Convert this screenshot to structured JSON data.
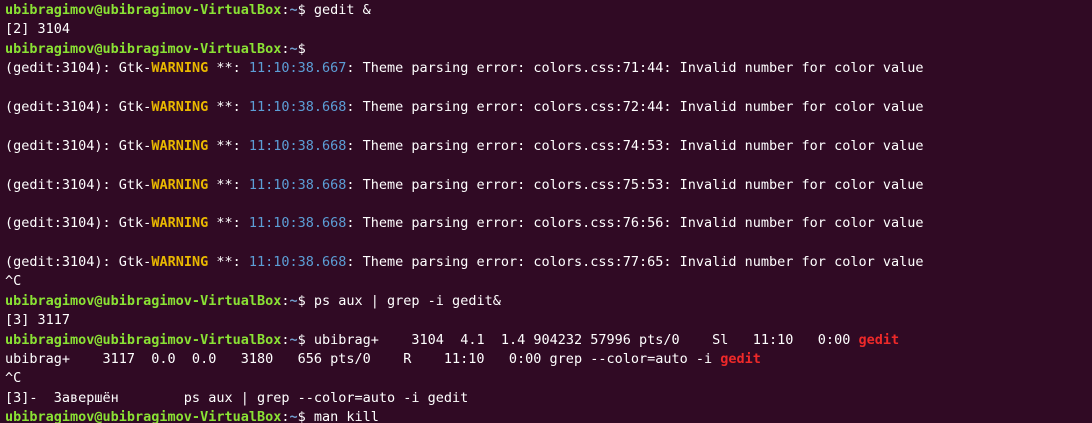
{
  "terminal": {
    "prompt": {
      "user_host": "ubibragimov@ubibragimov-VirtualBox",
      "colon": ":",
      "path": "~",
      "symbol": "$ "
    },
    "lines": [
      {
        "kind": "prompt",
        "cmd": "gedit &"
      },
      {
        "kind": "text",
        "text": "[2] 3104"
      },
      {
        "kind": "prompt",
        "cmd": ""
      },
      {
        "kind": "warning",
        "prefix": "(gedit:3104): Gtk-",
        "level": "WARNING",
        "mid": " **: ",
        "time": "11:10:38.667",
        "message": ": Theme parsing error: colors.css:71:44: Invalid number for color value"
      },
      {
        "kind": "blank"
      },
      {
        "kind": "warning",
        "prefix": "(gedit:3104): Gtk-",
        "level": "WARNING",
        "mid": " **: ",
        "time": "11:10:38.668",
        "message": ": Theme parsing error: colors.css:72:44: Invalid number for color value"
      },
      {
        "kind": "blank"
      },
      {
        "kind": "warning",
        "prefix": "(gedit:3104): Gtk-",
        "level": "WARNING",
        "mid": " **: ",
        "time": "11:10:38.668",
        "message": ": Theme parsing error: colors.css:74:53: Invalid number for color value"
      },
      {
        "kind": "blank"
      },
      {
        "kind": "warning",
        "prefix": "(gedit:3104): Gtk-",
        "level": "WARNING",
        "mid": " **: ",
        "time": "11:10:38.668",
        "message": ": Theme parsing error: colors.css:75:53: Invalid number for color value"
      },
      {
        "kind": "blank"
      },
      {
        "kind": "warning",
        "prefix": "(gedit:3104): Gtk-",
        "level": "WARNING",
        "mid": " **: ",
        "time": "11:10:38.668",
        "message": ": Theme parsing error: colors.css:76:56: Invalid number for color value"
      },
      {
        "kind": "blank"
      },
      {
        "kind": "warning",
        "prefix": "(gedit:3104): Gtk-",
        "level": "WARNING",
        "mid": " **: ",
        "time": "11:10:38.668",
        "message": ": Theme parsing error: colors.css:77:65: Invalid number for color value"
      },
      {
        "kind": "text",
        "text": "^C"
      },
      {
        "kind": "prompt",
        "cmd": "ps aux | grep -i gedit&"
      },
      {
        "kind": "text",
        "text": "[3] 3117"
      },
      {
        "kind": "prompt",
        "cmd": "ubibrag+    3104  4.1  1.4 904232 57996 pts/0    Sl   11:10   0:00 ",
        "match": "gedit"
      },
      {
        "kind": "text",
        "text": "ubibrag+    3117  0.0  0.0   3180   656 pts/0    R    11:10   0:00 grep --color=auto -i ",
        "match": "gedit"
      },
      {
        "kind": "text",
        "text": "^C"
      },
      {
        "kind": "text",
        "text": "[3]-  Завершён        ps aux | grep --color=auto -i gedit"
      },
      {
        "kind": "prompt",
        "cmd": "man kill"
      }
    ]
  },
  "colors": {
    "background": "#300a24",
    "prompt_user": "#8ae234",
    "prompt_path": "#729fcf",
    "warning": "#e9b800",
    "timestamp": "#5c9ed6",
    "grep_match": "#ef2929",
    "text": "#ffffff"
  }
}
